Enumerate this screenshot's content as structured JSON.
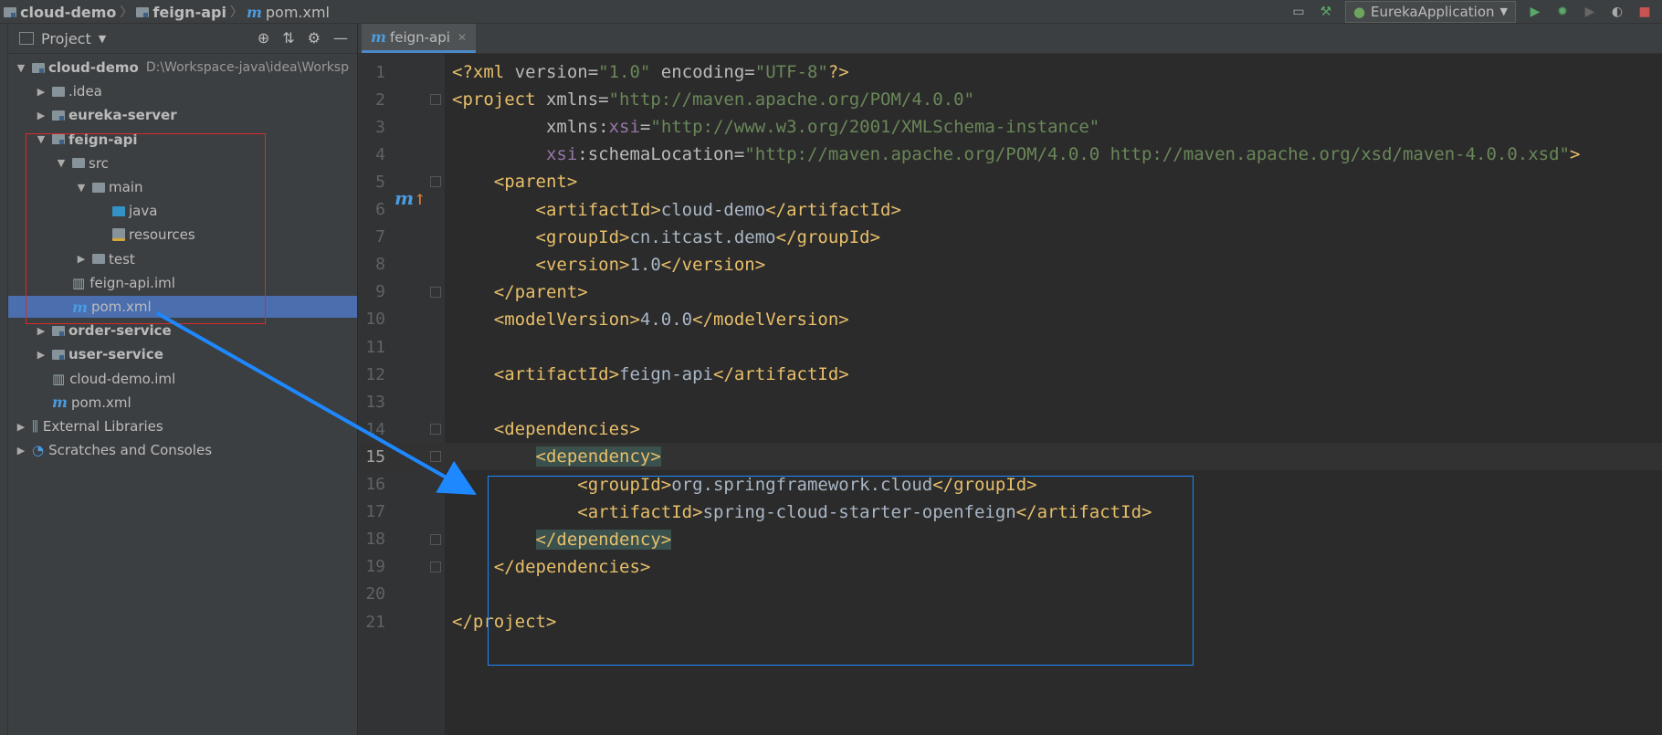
{
  "breadcrumb": {
    "project": "cloud-demo",
    "module": "feign-api",
    "file": "pom.xml"
  },
  "toolbar": {
    "run_config": "EurekaApplication",
    "icons": [
      "layout-icon",
      "build-hammer-icon",
      "run-icon",
      "debug-icon",
      "run-coverage-icon",
      "profile-icon",
      "stop-icon"
    ]
  },
  "project_panel": {
    "title": "Project",
    "tree": [
      {
        "label": "cloud-demo",
        "path": "D:\\Workspace-java\\idea\\Worksp",
        "bold": true,
        "depth": 0,
        "arrow": "expanded",
        "icon": "module-folder"
      },
      {
        "label": ".idea",
        "bold": false,
        "depth": 1,
        "arrow": "collapsed",
        "icon": "folder"
      },
      {
        "label": "eureka-server",
        "bold": true,
        "depth": 1,
        "arrow": "collapsed",
        "icon": "module-folder"
      },
      {
        "label": "feign-api",
        "bold": true,
        "depth": 1,
        "arrow": "expanded",
        "icon": "module-folder"
      },
      {
        "label": "src",
        "bold": false,
        "depth": 2,
        "arrow": "expanded",
        "icon": "folder"
      },
      {
        "label": "main",
        "bold": false,
        "depth": 3,
        "arrow": "expanded",
        "icon": "folder"
      },
      {
        "label": "java",
        "bold": false,
        "depth": 4,
        "arrow": "none",
        "icon": "source-folder"
      },
      {
        "label": "resources",
        "bold": false,
        "depth": 4,
        "arrow": "none",
        "icon": "resources-folder"
      },
      {
        "label": "test",
        "bold": false,
        "depth": 3,
        "arrow": "collapsed",
        "icon": "folder"
      },
      {
        "label": "feign-api.iml",
        "bold": false,
        "depth": 2,
        "arrow": "none",
        "icon": "iml-file"
      },
      {
        "label": "pom.xml",
        "bold": false,
        "depth": 2,
        "arrow": "none",
        "icon": "maven-file",
        "selected": true
      },
      {
        "label": "order-service",
        "bold": true,
        "depth": 1,
        "arrow": "collapsed",
        "icon": "module-folder"
      },
      {
        "label": "user-service",
        "bold": true,
        "depth": 1,
        "arrow": "collapsed",
        "icon": "module-folder"
      },
      {
        "label": "cloud-demo.iml",
        "bold": false,
        "depth": 1,
        "arrow": "none",
        "icon": "iml-file"
      },
      {
        "label": "pom.xml",
        "bold": false,
        "depth": 1,
        "arrow": "none",
        "icon": "maven-file"
      },
      {
        "label": "External Libraries",
        "bold": false,
        "depth": 0,
        "arrow": "collapsed",
        "icon": "libraries"
      },
      {
        "label": "Scratches and Consoles",
        "bold": false,
        "depth": 0,
        "arrow": "collapsed",
        "icon": "scratches"
      }
    ]
  },
  "editor": {
    "tab_label": "feign-api",
    "current_line": 15,
    "lines": [
      {
        "n": "1",
        "segs": [
          [
            "t",
            "<?xml "
          ],
          [
            "a",
            "version="
          ],
          [
            "s",
            "\"1.0\""
          ],
          [
            "a",
            " encoding="
          ],
          [
            "s",
            "\"UTF-8\""
          ],
          [
            "t",
            "?>"
          ]
        ]
      },
      {
        "n": "2",
        "segs": [
          [
            "t",
            "<project "
          ],
          [
            "a",
            "xmlns="
          ],
          [
            "s",
            "\"http://maven.apache.org/POM/4.0.0\""
          ]
        ]
      },
      {
        "n": "3",
        "segs": [
          [
            "a",
            "         xmlns:"
          ],
          [
            "ns",
            "xsi"
          ],
          [
            "a",
            "="
          ],
          [
            "s",
            "\"http://www.w3.org/2001/XMLSchema-instance\""
          ]
        ]
      },
      {
        "n": "4",
        "segs": [
          [
            "a",
            "         "
          ],
          [
            "ns",
            "xsi"
          ],
          [
            "a",
            ":schemaLocation="
          ],
          [
            "s",
            "\"http://maven.apache.org/POM/4.0.0 http://maven.apache.org/xsd/maven-4.0.0.xsd\""
          ],
          [
            "t",
            ">"
          ]
        ]
      },
      {
        "n": "5",
        "segs": [
          [
            "txt",
            "    "
          ],
          [
            "t",
            "<parent>"
          ]
        ]
      },
      {
        "n": "6",
        "segs": [
          [
            "txt",
            "        "
          ],
          [
            "t",
            "<artifactId>"
          ],
          [
            "txt",
            "cloud-demo"
          ],
          [
            "t",
            "</artifactId>"
          ]
        ]
      },
      {
        "n": "7",
        "segs": [
          [
            "txt",
            "        "
          ],
          [
            "t",
            "<groupId>"
          ],
          [
            "txt",
            "cn.itcast.demo"
          ],
          [
            "t",
            "</groupId>"
          ]
        ]
      },
      {
        "n": "8",
        "segs": [
          [
            "txt",
            "        "
          ],
          [
            "t",
            "<version>"
          ],
          [
            "txt",
            "1.0"
          ],
          [
            "t",
            "</version>"
          ]
        ]
      },
      {
        "n": "9",
        "segs": [
          [
            "txt",
            "    "
          ],
          [
            "t",
            "</parent>"
          ]
        ]
      },
      {
        "n": "10",
        "segs": [
          [
            "txt",
            "    "
          ],
          [
            "t",
            "<modelVersion>"
          ],
          [
            "txt",
            "4.0.0"
          ],
          [
            "t",
            "</modelVersion>"
          ]
        ]
      },
      {
        "n": "11",
        "segs": []
      },
      {
        "n": "12",
        "segs": [
          [
            "txt",
            "    "
          ],
          [
            "t",
            "<artifactId>"
          ],
          [
            "txt",
            "feign-api"
          ],
          [
            "t",
            "</artifactId>"
          ]
        ]
      },
      {
        "n": "13",
        "segs": []
      },
      {
        "n": "14",
        "segs": [
          [
            "txt",
            "    "
          ],
          [
            "t",
            "<dependencies>"
          ]
        ]
      },
      {
        "n": "15",
        "segs": [
          [
            "txt",
            "        "
          ],
          [
            "thl",
            "<dependency>"
          ]
        ]
      },
      {
        "n": "16",
        "segs": [
          [
            "txt",
            "            "
          ],
          [
            "t",
            "<groupId>"
          ],
          [
            "txt",
            "org.springframework.cloud"
          ],
          [
            "t",
            "</groupId>"
          ]
        ]
      },
      {
        "n": "17",
        "segs": [
          [
            "txt",
            "            "
          ],
          [
            "t",
            "<artifactId>"
          ],
          [
            "txt",
            "spring-cloud-starter-openfeign"
          ],
          [
            "t",
            "</artifactId>"
          ]
        ]
      },
      {
        "n": "18",
        "segs": [
          [
            "txt",
            "        "
          ],
          [
            "thl",
            "</dependency>"
          ]
        ]
      },
      {
        "n": "19",
        "segs": [
          [
            "txt",
            "    "
          ],
          [
            "t",
            "</dependencies>"
          ]
        ]
      },
      {
        "n": "20",
        "segs": []
      },
      {
        "n": "21",
        "segs": [
          [
            "t",
            "</project>"
          ]
        ]
      }
    ]
  },
  "colors": {
    "selection": "#4b6eaf",
    "annotation_red": "#d62b2b",
    "annotation_blue": "#1e88ff",
    "tag": "#e8bf6a",
    "string": "#6a8759"
  }
}
